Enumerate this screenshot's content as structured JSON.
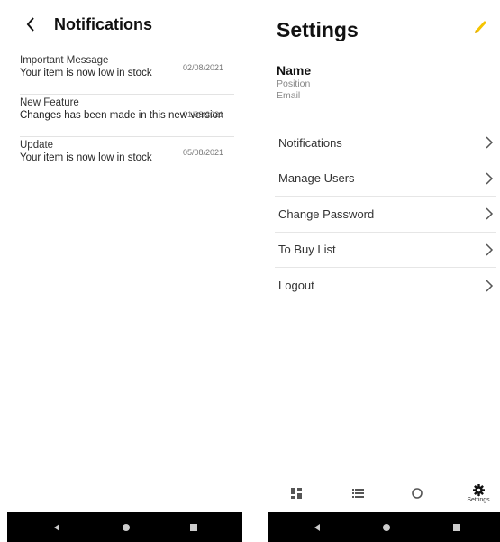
{
  "notifications_screen": {
    "title": "Notifications",
    "back_icon": "chevron-left-icon",
    "items": [
      {
        "heading": "Important Message",
        "body": "Your item is now low in stock",
        "date": "02/08/2021"
      },
      {
        "heading": "New Feature",
        "body": "Changes has been made in this new version",
        "date": "01/08/2021"
      },
      {
        "heading": "Update",
        "body": "Your item is now low in stock",
        "date": "05/08/2021"
      }
    ]
  },
  "settings_screen": {
    "title": "Settings",
    "edit_icon": "pencil-icon",
    "accent_color": "#f5c400",
    "profile": {
      "name": "Name",
      "position": "Position",
      "email": "Email"
    },
    "menu": [
      {
        "label": "Notifications"
      },
      {
        "label": "Manage Users"
      },
      {
        "label": "Change Password"
      },
      {
        "label": "To Buy List"
      },
      {
        "label": "Logout"
      }
    ],
    "tabbar": [
      {
        "icon": "dashboard-icon",
        "label": ""
      },
      {
        "icon": "list-icon",
        "label": ""
      },
      {
        "icon": "circle-icon",
        "label": ""
      },
      {
        "icon": "gear-icon",
        "label": "Settings",
        "active": true
      }
    ]
  },
  "system_nav": {
    "back_icon": "back-triangle-icon",
    "home_icon": "home-circle-icon",
    "recents_icon": "recents-square-icon"
  }
}
